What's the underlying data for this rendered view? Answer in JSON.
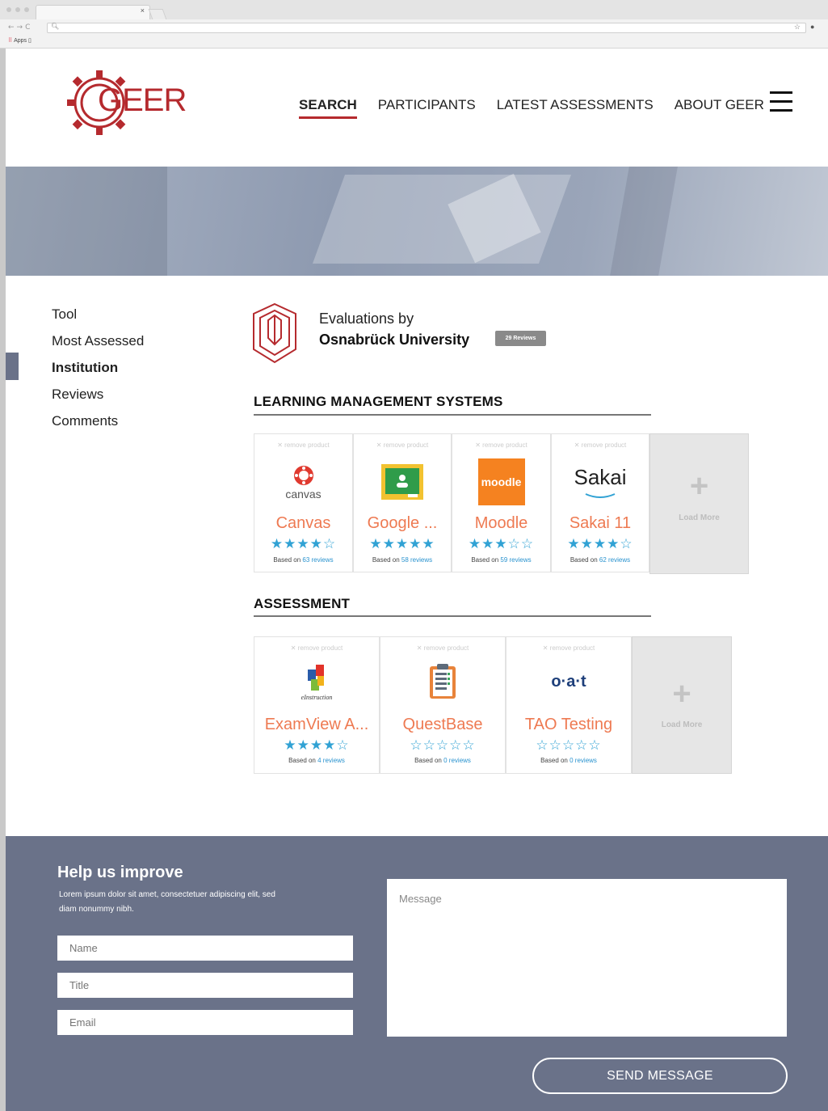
{
  "browser": {
    "tab_close": "×",
    "bookmarks_label": "Apps"
  },
  "brand": {
    "logo_text": "GEER",
    "accent_color": "#b52a2e"
  },
  "nav": {
    "items": [
      "SEARCH",
      "PARTICIPANTS",
      "LATEST ASSESSMENTS",
      "ABOUT GEER"
    ],
    "active": "SEARCH"
  },
  "sidebar": {
    "items": [
      "Tool",
      "Most Assessed",
      "Institution",
      "Reviews",
      "Comments"
    ],
    "active": "Institution"
  },
  "institution": {
    "by_label": "Evaluations by",
    "name": "Osnabrück University",
    "badge": "29 Reviews"
  },
  "sections": [
    {
      "title": "LEARNING MANAGEMENT SYSTEMS",
      "products": [
        {
          "remove": "remove product",
          "name": "Canvas",
          "logo": "canvas-logo",
          "logo_text": "canvas",
          "stars": "★★★★☆",
          "based_on": "Based on",
          "reviews": "63 reviews"
        },
        {
          "remove": "remove product",
          "name": "Google ...",
          "logo": "google-classroom-logo",
          "stars": "★★★★★",
          "based_on": "Based on",
          "reviews": "58 reviews"
        },
        {
          "remove": "remove product",
          "name": "Moodle",
          "logo": "moodle-logo",
          "logo_text": "moodle",
          "stars": "★★★☆☆",
          "based_on": "Based on",
          "reviews": "59 reviews"
        },
        {
          "remove": "remove product",
          "name": "Sakai 11",
          "logo": "sakai-logo",
          "logo_text": "Sakai",
          "stars": "★★★★☆",
          "based_on": "Based on",
          "reviews": "62 reviews"
        }
      ],
      "load_more": "Load More"
    },
    {
      "title": "ASSESSMENT",
      "products": [
        {
          "remove": "remove product",
          "name": "ExamView A...",
          "logo": "einstruction-logo",
          "logo_text": "eInstruction",
          "stars": "★★★★☆",
          "based_on": "Based on",
          "reviews": "4 reviews"
        },
        {
          "remove": "remove product",
          "name": "QuestBase",
          "logo": "questbase-clipboard-logo",
          "stars": "☆☆☆☆☆",
          "based_on": "Based on",
          "reviews": "0 reviews"
        },
        {
          "remove": "remove product",
          "name": "TAO Testing",
          "logo": "oat-logo",
          "logo_text": "o·a·t",
          "stars": "☆☆☆☆☆",
          "based_on": "Based on",
          "reviews": "0 reviews"
        }
      ],
      "load_more": "Load More"
    }
  ],
  "footer": {
    "title": "Help us improve",
    "description": "Lorem ipsum dolor sit amet, consectetuer adipiscing elit, sed diam nonummy nibh.",
    "name_placeholder": "Name",
    "title_placeholder": "Title",
    "email_placeholder": "Email",
    "message_placeholder": "Message",
    "send_label": "SEND MESSAGE"
  }
}
